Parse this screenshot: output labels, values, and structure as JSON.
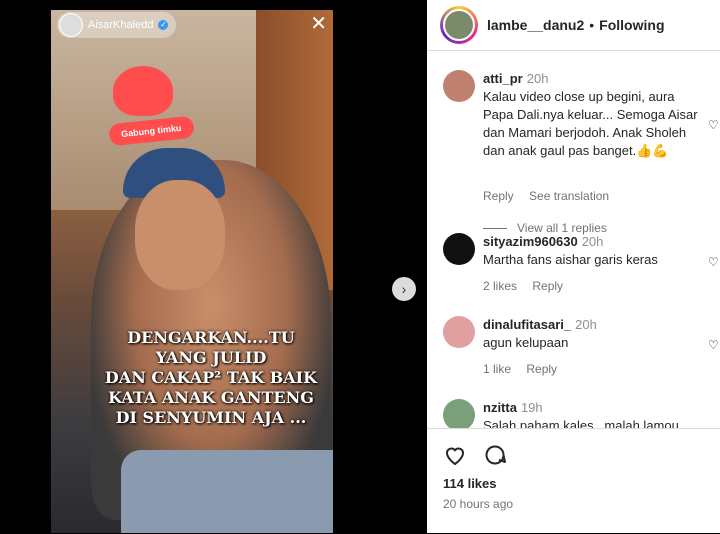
{
  "media": {
    "author": "AisarKhaledd",
    "sticker_label": "Gabung timku",
    "caption_lines": [
      "DENGARKAN....TU",
      "YANG JULID",
      "DAN CAKAP² TAK BAIK",
      "KATA ANAK GANTENG",
      "DI SENYUMIN AJA ..."
    ]
  },
  "header": {
    "username": "lambe__danu2",
    "separator": "•",
    "follow_label": "Following"
  },
  "comments": [
    {
      "user": "atti_pr",
      "time": "20h",
      "text": "Kalau video close up begini, aura Papa Dali.nya keluar... Semoga Aisar dan Mamari berjodoh. Anak Sholeh dan anak gaul pas banget.👍💪",
      "reply_label": "Reply",
      "translate_label": "See translation",
      "view_replies": "View all 1 replies"
    },
    {
      "user": "sityazim960630",
      "time": "20h",
      "text": "Martha fans aishar garis keras",
      "likes": "2 likes",
      "reply_label": "Reply"
    },
    {
      "user": "dinalufitasari_",
      "time": "20h",
      "text": "agun kelupaan",
      "likes": "1 like",
      "reply_label": "Reply"
    },
    {
      "user": "nzitta",
      "time": "19h",
      "text": "Salah paham kales.. malah lamou"
    }
  ],
  "footer": {
    "likes": "114 likes",
    "time_ago": "20 hours ago"
  }
}
